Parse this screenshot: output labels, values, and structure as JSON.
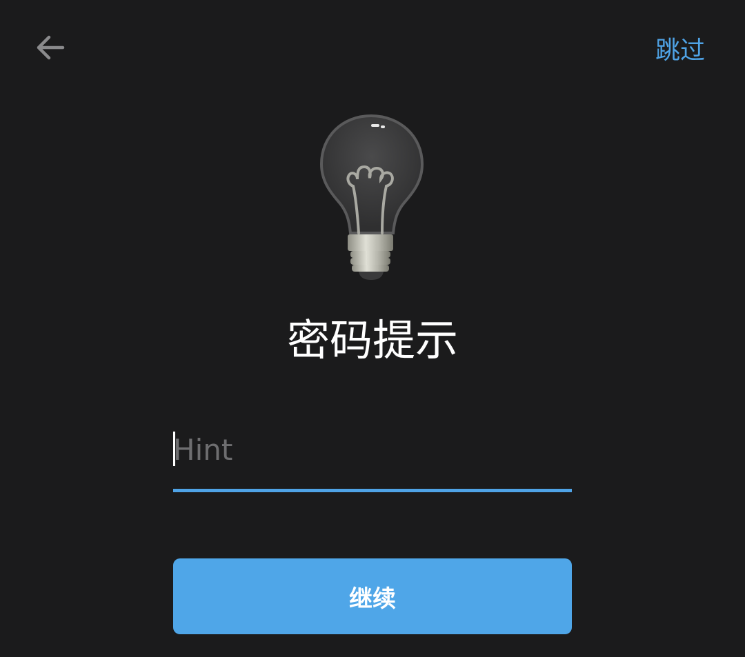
{
  "header": {
    "back_icon": "arrow-left-icon",
    "skip_label": "跳过"
  },
  "illustration": {
    "icon": "light-bulb-icon"
  },
  "main": {
    "title": "密码提示",
    "hint_input": {
      "placeholder": "Hint",
      "value": ""
    },
    "continue_label": "继续"
  },
  "colors": {
    "background": "#1b1b1c",
    "accent": "#4fa3e6",
    "button": "#4fa6e8",
    "title_text": "#ffffff",
    "placeholder_text": "#6e6e70"
  }
}
